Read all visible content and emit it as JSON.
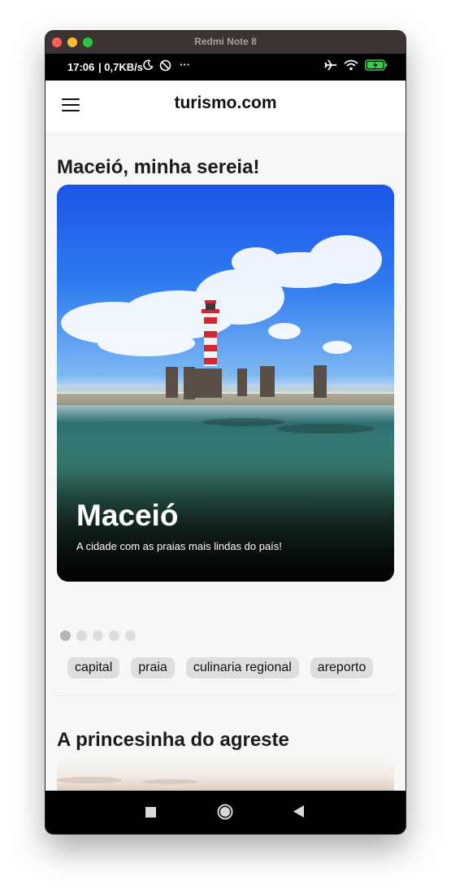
{
  "window": {
    "title": "Redmi Note 8"
  },
  "status_bar": {
    "time": "17:06",
    "network_speed": "| 0,7KB/s",
    "more": "···"
  },
  "app_bar": {
    "title": "turismo.com"
  },
  "sections": [
    {
      "title": "Maceió, minha sereia!",
      "card": {
        "title": "Maceió",
        "subtitle": "A cidade com as praias mais lindas do país!"
      },
      "carousel": {
        "count": 5,
        "active_index": 0
      },
      "tags": [
        "capital",
        "praia",
        "culinaria regional",
        "areporto"
      ]
    },
    {
      "title": "A princesinha do agreste"
    }
  ],
  "colors": {
    "accent": "#111111",
    "chip_bg": "#dedede",
    "screen_bg": "#f7f7f7"
  },
  "icons": [
    "menu-icon",
    "moon-icon",
    "dnd-icon",
    "airplane-icon",
    "wifi-icon",
    "battery-icon",
    "square-nav-icon",
    "circle-nav-icon",
    "back-nav-icon"
  ]
}
